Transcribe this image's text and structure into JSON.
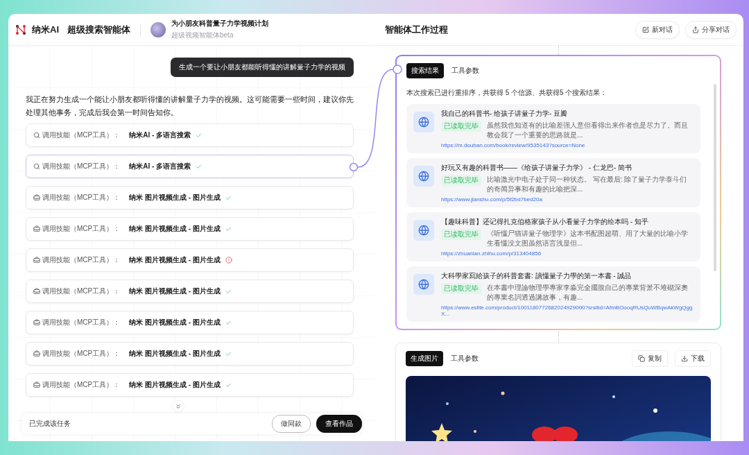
{
  "header": {
    "brand": "纳米AI",
    "product": "超级搜索智能体",
    "project": {
      "title": "为小朋友科普量子力学视频计划",
      "subtitle": "超级视频智能体beta"
    },
    "panel_title": "智能体工作过程",
    "actions": [
      {
        "kind": "new",
        "label": "新对话"
      },
      {
        "kind": "share",
        "label": "分享对话"
      }
    ]
  },
  "chat": {
    "user_message": "生成一个要让小朋友都能听得懂的讲解量子力学的视频",
    "reply": "我正在努力生成一个能让小朋友都听得懂的讲解量子力学的视频。这可能需要一些时间，建议你先处理其他事务，完成后我会第一时间告知你。",
    "steps": [
      {
        "kind": "search",
        "label": "调用技能（MCP工具）：",
        "tool": "纳米AI - 多语言搜索",
        "failed": false,
        "selected": false
      },
      {
        "kind": "search",
        "label": "调用技能（MCP工具）：",
        "tool": "纳米AI - 多语言搜索",
        "failed": false,
        "selected": true
      },
      {
        "kind": "tool",
        "label": "调用技能（MCP工具）：",
        "tool": "纳米 图片视频生成 - 图片生成",
        "failed": false,
        "selected": false
      },
      {
        "kind": "tool",
        "label": "调用技能（MCP工具）：",
        "tool": "纳米 图片视频生成 - 图片生成",
        "failed": false,
        "selected": false
      },
      {
        "kind": "tool",
        "label": "调用技能（MCP工具）：",
        "tool": "纳米 图片视频生成 - 图片生成",
        "failed": true,
        "selected": false
      },
      {
        "kind": "tool",
        "label": "调用技能（MCP工具）：",
        "tool": "纳米 图片视频生成 - 图片生成",
        "failed": false,
        "selected": false
      },
      {
        "kind": "tool",
        "label": "调用技能（MCP工具）：",
        "tool": "纳米 图片视频生成 - 图片生成",
        "failed": false,
        "selected": false
      },
      {
        "kind": "tool",
        "label": "调用技能（MCP工具）：",
        "tool": "纳米 图片视频生成 - 图片生成",
        "failed": false,
        "selected": false
      },
      {
        "kind": "tool",
        "label": "调用技能（MCP工具）：",
        "tool": "纳米 图片视频生成 - 图片生成",
        "failed": false,
        "selected": false
      }
    ],
    "footer": {
      "status": "已完成该任务",
      "buttons": [
        {
          "kind": "outline",
          "label": "做同款"
        },
        {
          "kind": "solid",
          "label": "查看作品"
        }
      ]
    }
  },
  "search_card": {
    "tabs": [
      {
        "label": "搜索结果",
        "selected": true
      },
      {
        "label": "工具参数",
        "selected": false
      }
    ],
    "summary": "本次搜索已进行重排序，共获得 5 个信源、共获得5 个搜索结果：",
    "results": [
      {
        "title": "我自己的科普书- 给孩子讲量子力学- 豆瓣",
        "badge": "已读取完毕",
        "snippet": "虽然我也知道有的比喻差强人意但看得出来作者也是尽力了。而且教会我了一个重要的思路就是...",
        "url": "https://m.douban.com/book/review/9535143?source=None"
      },
      {
        "title": "好玩又有趣的科普书——《给孩子讲量子力学》 - 仁龙巴- 简书",
        "badge": "已读取完毕",
        "snippet": "比喻激光中电子处于同一种状态。 写在最后: 除了量子力学泰斗们的奇闻异事和有趣的比喻把深...",
        "url": "https://www.jianshu.com/p/5f2bd7bed20a"
      },
      {
        "title": "【趣味科普】还记得扎克伯格家孩子从小看量子力学的绘本吗 - 知乎",
        "badge": "已读取完毕",
        "snippet": "《听懂尸猫讲量子物理学》这本书配图超萌、用了大量的比喻小学生看懂没文图虽然语言浅显但...",
        "url": "https://zhuanlan.zhihu.com/p/313404856"
      },
      {
        "title": "大科學家寫給孩子的科普套書: 讀懂量子力學的第一本書 - 誠品",
        "badge": "已读取完毕",
        "snippet": "在本書中理論物理學專家李淼完全擺脫自己的專業背景不堆砌深奧的專業名詞透過講故事，有趣...",
        "url": "https://www.eslite.com/product/1001180772682024929000?srsltid=AfmBOooqRUsQuWBqwAkWgQggX..."
      }
    ]
  },
  "image_card": {
    "tabs": [
      {
        "label": "生成图片",
        "selected": true
      },
      {
        "label": "工具参数",
        "selected": false
      }
    ],
    "actions": [
      {
        "kind": "copy",
        "label": "复制"
      },
      {
        "kind": "download",
        "label": "下载"
      }
    ]
  }
}
